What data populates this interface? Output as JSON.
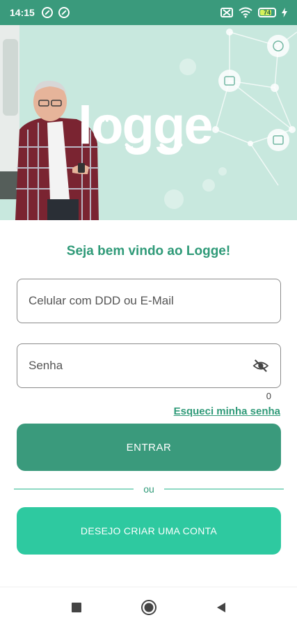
{
  "status_bar": {
    "time": "14:15",
    "battery_level": "74",
    "icons": [
      "at-sign-icon",
      "at-sign-icon",
      "notification-off-icon",
      "wifi-icon",
      "battery-icon",
      "charging-bolt-icon"
    ]
  },
  "banner": {
    "logo_text": "logge",
    "background_color": "#c8e8de",
    "brand_color": "#3a9a7c"
  },
  "login": {
    "welcome_text": "Seja bem vindo ao Logge!",
    "phone_email_placeholder": "Celular com DDD ou E-Mail",
    "password_placeholder": "Senha",
    "password_counter": "0",
    "forgot_password_label": "Esqueci minha senha",
    "login_button_label": "ENTRAR",
    "divider_text": "ou",
    "create_account_button_label": "DESEJO CRIAR UMA CONTA"
  },
  "colors": {
    "primary": "#3a9a7c",
    "secondary": "#2ec9a0",
    "accent_text": "#2f9a78"
  },
  "nav_bar": {
    "icons": [
      "recent-apps-icon",
      "home-icon",
      "back-icon"
    ]
  }
}
